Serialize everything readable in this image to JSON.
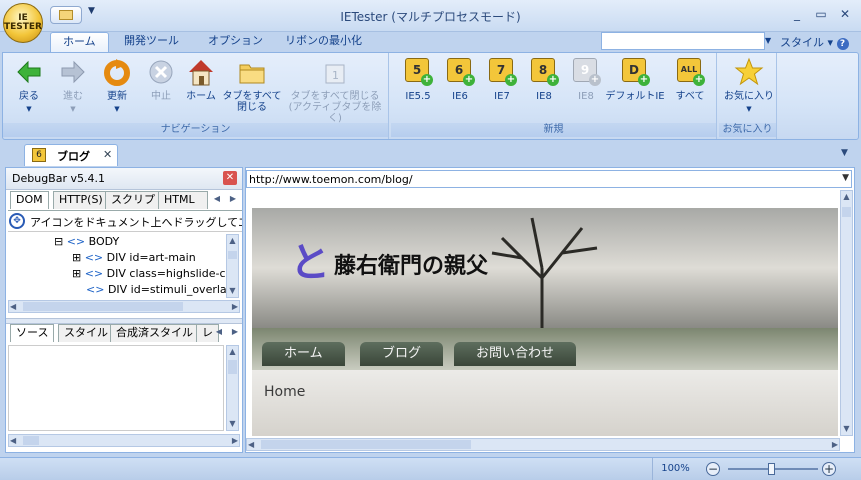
{
  "app": {
    "title": "IETester (マルチプロセスモード)",
    "orb": "IE\nTESTER"
  },
  "ribbon_tabs": [
    {
      "label": "ホーム"
    },
    {
      "label": "開発ツール"
    },
    {
      "label": "オプション"
    },
    {
      "label": "リボンの最小化"
    }
  ],
  "style_label": "スタイル",
  "nav_group": {
    "label": "ナビゲーション",
    "buttons": [
      {
        "label": "戻る",
        "icon": "back-arrow-icon"
      },
      {
        "label": "進む",
        "icon": "forward-arrow-icon"
      },
      {
        "label": "更新",
        "icon": "refresh-icon"
      },
      {
        "label": "中止",
        "icon": "stop-icon"
      },
      {
        "label": "ホーム",
        "icon": "home-icon"
      },
      {
        "label1": "タブをすべて",
        "label2": "閉じる",
        "icon": "folder-icon"
      },
      {
        "label1": "タブをすべて閉じる",
        "label2": "(アクティブタブを除く)",
        "icon": "tab-close-icon"
      }
    ]
  },
  "new_group": {
    "label": "新規",
    "buttons": [
      {
        "label": "IE5.5",
        "badge": "5"
      },
      {
        "label": "IE6",
        "badge": "6"
      },
      {
        "label": "IE7",
        "badge": "7"
      },
      {
        "label": "IE8",
        "badge": "8"
      },
      {
        "label": "IE8",
        "badge": "9"
      },
      {
        "label": "デフォルトIE",
        "badge": "D"
      },
      {
        "label": "すべて",
        "badge": "ALL"
      }
    ]
  },
  "fav_group": {
    "label": "お気に入り",
    "button": "お気に入り"
  },
  "doc_tab": {
    "label": "ブログ",
    "badge": "6"
  },
  "debugbar": {
    "title": "DebugBar v5.4.1",
    "tabs": [
      "DOM",
      "HTTP(S)",
      "スクリプト",
      "HTMLチェッ"
    ],
    "drag_hint": "アイコンをドキュメント上へドラッグしてエレメント",
    "tree": [
      {
        "text": "BODY"
      },
      {
        "text": "DIV id=art-main"
      },
      {
        "text": "DIV class=highslide-con"
      },
      {
        "text": "DIV id=stimuli_overlay"
      }
    ],
    "bottom_tabs": [
      "ソース",
      "スタイル",
      "合成済スタイル",
      "レ"
    ]
  },
  "browser": {
    "url": "http://www.toemon.com/blog/",
    "site_title": "藤右衛門の親父",
    "nav": [
      "ホーム",
      "ブログ",
      "お問い合わせ"
    ],
    "breadcrumb": "Home"
  },
  "status": {
    "zoom": "100%"
  },
  "colors": {
    "ribbon": "#d5e4f7",
    "accent": "#15428b",
    "orb": "#f3c63a"
  }
}
